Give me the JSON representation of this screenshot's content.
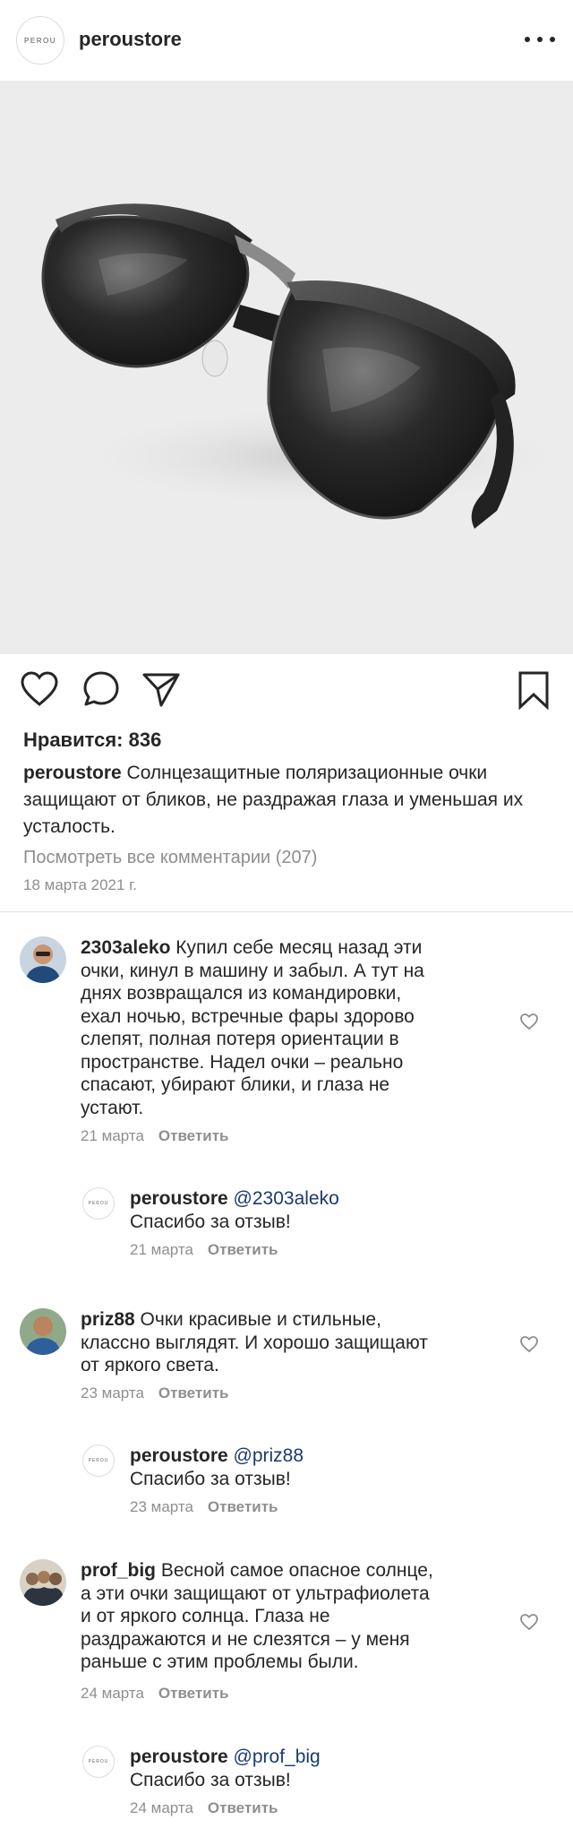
{
  "account": {
    "username": "peroustore",
    "logo_text": "PEROU"
  },
  "post": {
    "likes": "Нравится: 836",
    "caption_user": "peroustore",
    "caption_text": "Солнцезащитные поляризационные очки защищают от бликов, не раздражая глаза и уменьшая их усталость.",
    "view_all": "Посмотреть все комментарии (207)",
    "date": "18 марта 2021 г."
  },
  "comments": [
    {
      "user": "2303aleko",
      "lines": [
        "Купил себе месяц назад эти",
        "очки, кинул в машину и забыл. А тут на",
        "днях возвращался из командировки,",
        "ехал ночью, встречные фары здорово",
        "слепят, полная потеря ориентации в",
        "пространстве. Надел очки – реально",
        "спасают, убирают блики, и глаза не",
        "устают."
      ],
      "date": "21 марта",
      "reply_label": "Ответить",
      "reply": {
        "user": "peroustore",
        "mention": "@2303aleko",
        "text": "Спасибо за отзыв!",
        "date": "21 марта",
        "reply_label": "Ответить"
      }
    },
    {
      "user": "priz88",
      "lines": [
        "Очки красивые и стильные,",
        "классно выглядят. И хорошо защищают",
        "от яркого света."
      ],
      "date": "23 марта",
      "reply_label": "Ответить",
      "reply": {
        "user": "peroustore",
        "mention": "@priz88",
        "text": "Спасибо за отзыв!",
        "date": "23 марта",
        "reply_label": "Ответить"
      }
    },
    {
      "user": "prof_big",
      "lines": [
        "Весной самое опасное солнце,",
        "а эти очки защищают от ультрафиолета",
        "и от яркого солнца. Глаза не",
        "раздражаются и не слезятся – у меня",
        "раньше с этим проблемы были."
      ],
      "date": "24 марта",
      "reply_label": "Ответить",
      "reply": {
        "user": "peroustore",
        "mention": "@prof_big",
        "text": "Спасибо за отзыв!",
        "date": "24 марта",
        "reply_label": "Ответить"
      }
    }
  ],
  "icons": [
    "more-icon",
    "heart-icon",
    "comment-icon",
    "share-icon",
    "bookmark-icon",
    "like-comment-icon"
  ]
}
